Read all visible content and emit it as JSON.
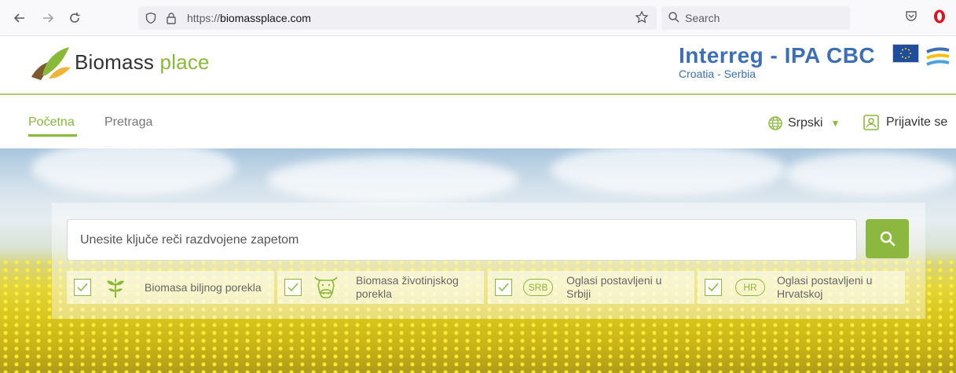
{
  "browser": {
    "url_protocol": "https://",
    "url_domain": "biomassplace.com",
    "search_placeholder": "Search"
  },
  "header": {
    "logo_main": "Biomass",
    "logo_accent": "place",
    "partner_title": "Interreg - IPA CBC",
    "partner_subtitle": "Croatia - Serbia"
  },
  "nav": {
    "items": [
      {
        "label": "Početna",
        "active": true
      },
      {
        "label": "Pretraga",
        "active": false
      }
    ],
    "language": "Srpski",
    "login": "Prijavite se"
  },
  "search": {
    "placeholder": "Unesite ključe reči razdvojene zapetom",
    "filters": [
      {
        "label": "Biomasa biljnog porekla",
        "checked": true,
        "icon": "plant-icon"
      },
      {
        "label": "Biomasa životinjskog porekla",
        "checked": true,
        "icon": "cow-icon"
      },
      {
        "label": "Oglasi postavljeni u Srbiji",
        "checked": true,
        "icon": "srb-badge",
        "badge": "SRB"
      },
      {
        "label": "Oglasi postavljeni u Hrvatskoj",
        "checked": true,
        "icon": "hr-badge",
        "badge": "HR"
      }
    ]
  },
  "colors": {
    "brand_green": "#8ab93a",
    "interreg_blue": "#3c6fb5"
  }
}
